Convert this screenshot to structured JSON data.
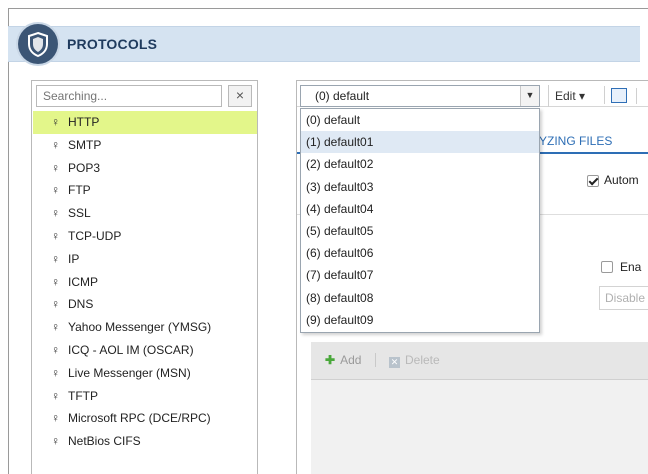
{
  "header": {
    "title": "PROTOCOLS"
  },
  "sidebar": {
    "search_placeholder": "Searching...",
    "clear_label": "×",
    "items": [
      {
        "label": "HTTP",
        "selected": true
      },
      {
        "label": "SMTP"
      },
      {
        "label": "POP3"
      },
      {
        "label": "FTP"
      },
      {
        "label": "SSL"
      },
      {
        "label": "TCP-UDP"
      },
      {
        "label": "IP"
      },
      {
        "label": "ICMP"
      },
      {
        "label": "DNS"
      },
      {
        "label": "Yahoo Messenger (YMSG)"
      },
      {
        "label": "ICQ - AOL IM (OSCAR)"
      },
      {
        "label": "Live Messenger (MSN)"
      },
      {
        "label": "TFTP"
      },
      {
        "label": "Microsoft RPC (DCE/RPC)"
      },
      {
        "label": "NetBios CIFS"
      }
    ]
  },
  "toolbar": {
    "profile_value": "(0) default",
    "edit_label": "Edit ▾",
    "calendar_icon": "calendar-icon"
  },
  "dropdown": {
    "options": [
      "(0) default",
      "(1) default01",
      "(2) default02",
      "(3) default03",
      "(4) default04",
      "(5) default05",
      "(6) default06",
      "(7) default07",
      "(8) default08",
      "(9) default09"
    ],
    "highlighted_index": 1
  },
  "main": {
    "tab_label": "YZING FILES",
    "auto_label": "Autom",
    "auto_checked": true,
    "enable_label": "Ena",
    "enable_checked": false,
    "disable_field_value": "Disable",
    "grid": {
      "add_label": "Add",
      "delete_label": "Delete"
    }
  },
  "colors": {
    "header_bg": "#d5e3f1",
    "selected_row": "#e3f68a",
    "tab_accent": "#2d6eb5",
    "dropdown_highlight": "#dfe9f4"
  }
}
